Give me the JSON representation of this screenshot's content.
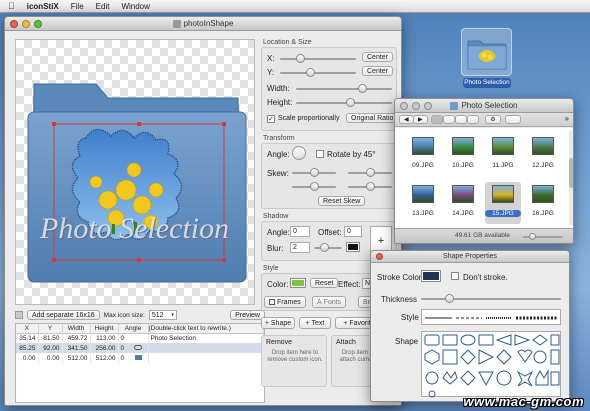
{
  "menubar": {
    "apple": "",
    "app": "iconStiX",
    "items": [
      "File",
      "Edit",
      "Window"
    ]
  },
  "desktop_icon": {
    "label": "Photo Selection"
  },
  "main_window": {
    "title": "photoInShape",
    "canvas_text": "Photo Selection",
    "bottom_bar": {
      "add_button": "Add separate 16x16",
      "max_icon_label": "Max icon size:",
      "max_icon_value": "512",
      "preview_button": "Preview"
    },
    "table": {
      "columns": [
        "X",
        "Y",
        "Width",
        "Height",
        "Angle",
        "(Double-click text to rewrite.)"
      ],
      "rows": [
        {
          "x": "35.14",
          "y": "81.50",
          "w": "459.72",
          "h": "113.00",
          "angle": "0",
          "text": "Photo Selection",
          "selected": false
        },
        {
          "x": "85.25",
          "y": "92.00",
          "w": "341.50",
          "h": "256.00",
          "angle": "0",
          "text": "",
          "selected": true
        },
        {
          "x": "0.00",
          "y": "0.00",
          "w": "512.00",
          "h": "512.00",
          "angle": "0",
          "text": "",
          "selected": false
        }
      ]
    },
    "location_size": {
      "header": "Location & Size",
      "x_label": "X:",
      "y_label": "Y:",
      "center_button": "Center",
      "width_label": "Width:",
      "height_label": "Height:",
      "scale_label": "Scale proportionally",
      "scale_checked": true,
      "original_ratio_button": "Original Ratio"
    },
    "transform": {
      "header": "Transform",
      "angle_label": "Angle:",
      "rotate_label": "Rotate by 45°",
      "skew_label": "Skew:",
      "reset_skew_button": "Reset Skew"
    },
    "shadow": {
      "header": "Shadow",
      "angle_label": "Angle:",
      "angle_value": "0",
      "offset_label": "Offset:",
      "offset_value": "0",
      "blur_label": "Blur:",
      "blur_value": "2",
      "plus": "+"
    },
    "style": {
      "header": "Style",
      "color_label": "Color:",
      "color": "#7fc440",
      "reset_button": "Reset",
      "effect_label": "Effect:",
      "effect_value": "No",
      "tabs": [
        "Frames",
        "Fonts",
        "Bevel"
      ]
    },
    "actions": {
      "shape_button": "+ Shape",
      "text_button": "+ Text",
      "favorite_button": "+ Favorite"
    },
    "remove": {
      "header": "Remove",
      "hint": "Drop item here to remove custom icon."
    },
    "attach": {
      "header": "Attach",
      "hint": "Drop item here to attach current icon."
    }
  },
  "photo_window": {
    "title": "Photo Selection",
    "status": "49.61 GB available",
    "items": [
      {
        "name": "09.JPG",
        "color": "#4a7db0"
      },
      {
        "name": "10.JPG",
        "color": "#3f8a3e"
      },
      {
        "name": "11.JPG",
        "color": "#5f8f3a"
      },
      {
        "name": "12.JPG",
        "color": "#4a7d48"
      },
      {
        "name": "13.JPG",
        "color": "#355f9a"
      },
      {
        "name": "14.JPG",
        "color": "#7a4a7f"
      },
      {
        "name": "15.JPG",
        "color": "#d9b21f",
        "selected": true
      },
      {
        "name": "16.JPG",
        "color": "#3c6a2c"
      }
    ]
  },
  "shape_props": {
    "title": "Shape Properties",
    "stroke_color_label": "Stroke Color",
    "stroke_color": "#1f3352",
    "dont_stroke_label": "Don't stroke.",
    "thickness_label": "Thickness",
    "style_label": "Style",
    "shape_label": "Shape"
  },
  "watermark": "www.mac-gm.com"
}
